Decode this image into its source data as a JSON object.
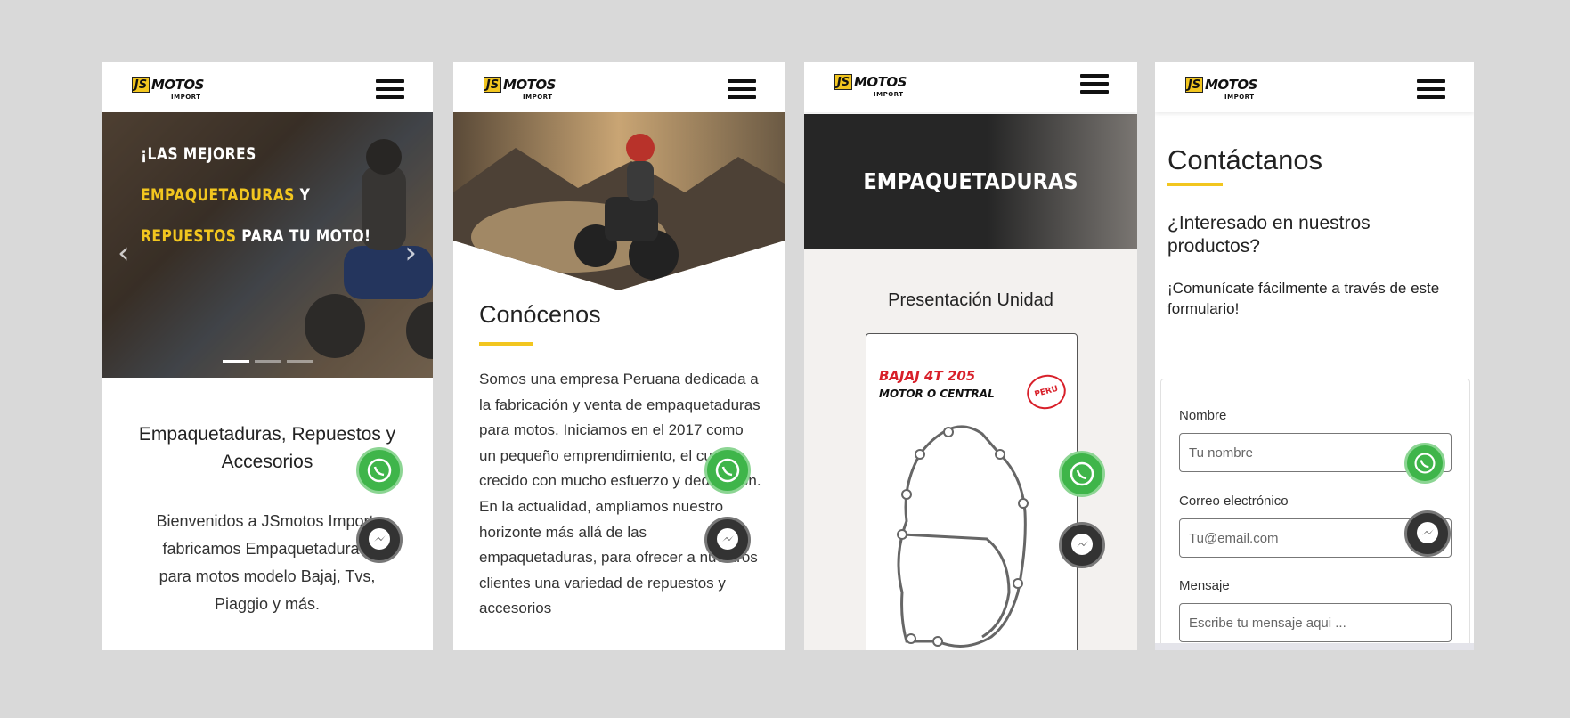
{
  "brand": {
    "logo_js": "JS",
    "logo_motos": "MOTOS",
    "logo_import": "IMPORT"
  },
  "colors": {
    "accent": "#f2c61f",
    "whatsapp": "#3fb54a",
    "messenger": "#333333",
    "background": "#d9d9d9"
  },
  "icons": {
    "menu": "hamburger-menu-icon",
    "whatsapp": "whatsapp-icon",
    "messenger": "messenger-icon",
    "prev": "chevron-left-icon",
    "next": "chevron-right-icon"
  },
  "screen1": {
    "hero_line1": "¡LAS MEJORES",
    "hero_line2_highlight": "EMPAQUETADURAS",
    "hero_line2_rest": " Y",
    "hero_line3_highlight": "REPUESTOS",
    "hero_line3_rest": " PARA TU MOTO!",
    "slide_count": 3,
    "active_slide": 1,
    "section_title": "Empaquetaduras, Repuestos y Accesorios",
    "body": "Bienvenidos a JSmotos Import, fabricamos Empaquetaduras, para motos modelo Bajaj, Tvs, Piaggio y más."
  },
  "screen2": {
    "title": "Conócenos",
    "body": "Somos una empresa Peruana dedicada a la fabricación y venta de empaquetaduras para motos. Iniciamos en el 2017 como un pequeño emprendimiento, el cual ha crecido con mucho esfuerzo y dedicación. En la actualidad, ampliamos nuestro horizonte más allá de las empaquetaduras, para ofrecer a nuestros clientes una variedad de repuestos y accesorios"
  },
  "screen3": {
    "banner_title": "EMPAQUETADURAS",
    "subtitle": "Presentación Unidad",
    "product_brand": "BAJAJ 4T 205",
    "product_model": "MOTOR O CENTRAL",
    "stamp_text": "PERU"
  },
  "screen4": {
    "title": "Contáctanos",
    "question": "¿Interesado en nuestros productos?",
    "subtitle": "¡Comunícate fácilmente a través de este formulario!",
    "form": {
      "name_label": "Nombre",
      "name_placeholder": "Tu nombre",
      "email_label": "Correo electrónico",
      "email_placeholder": "Tu@email.com",
      "message_label": "Mensaje",
      "message_placeholder": "Escribe tu mensaje aqui ..."
    }
  }
}
